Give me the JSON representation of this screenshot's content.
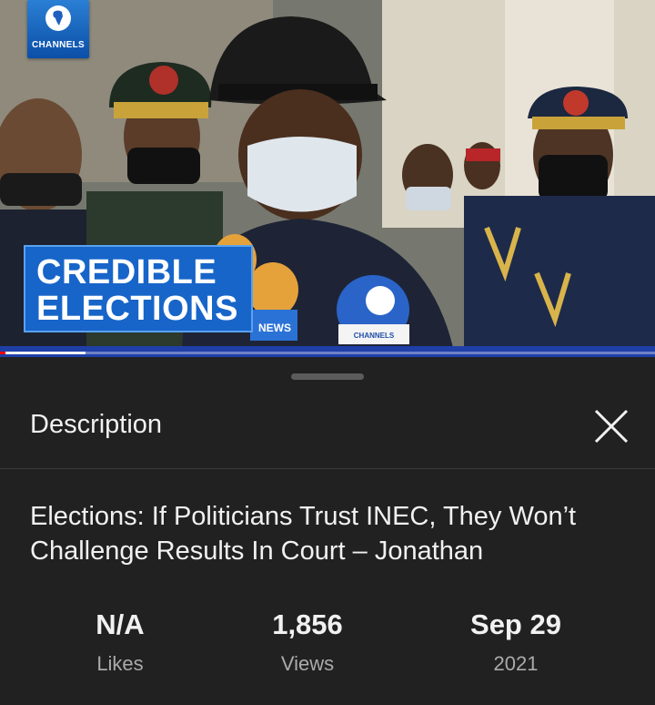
{
  "video": {
    "channel_logo_text": "CHANNELS",
    "chyron_line1": "CREDIBLE",
    "chyron_line2": "ELECTIONS",
    "mic_label_news": "NEWS",
    "mic_label_channels": "CHANNELS",
    "progress_fraction": 0.13
  },
  "sheet": {
    "header_title": "Description",
    "close_icon": "close-icon",
    "video_title": "Elections: If Politicians Trust INEC, They Won’t Challenge Results In Court – Jonathan",
    "stats": [
      {
        "value": "N/A",
        "label": "Likes"
      },
      {
        "value": "1,856",
        "label": "Views"
      },
      {
        "value": "Sep 29",
        "label": "2021"
      }
    ]
  },
  "colors": {
    "sheet_bg": "#212121",
    "chyron_blue": "#1765c9",
    "progress_blue": "#1f3fa8",
    "secondary_text": "#aaaaaa"
  }
}
